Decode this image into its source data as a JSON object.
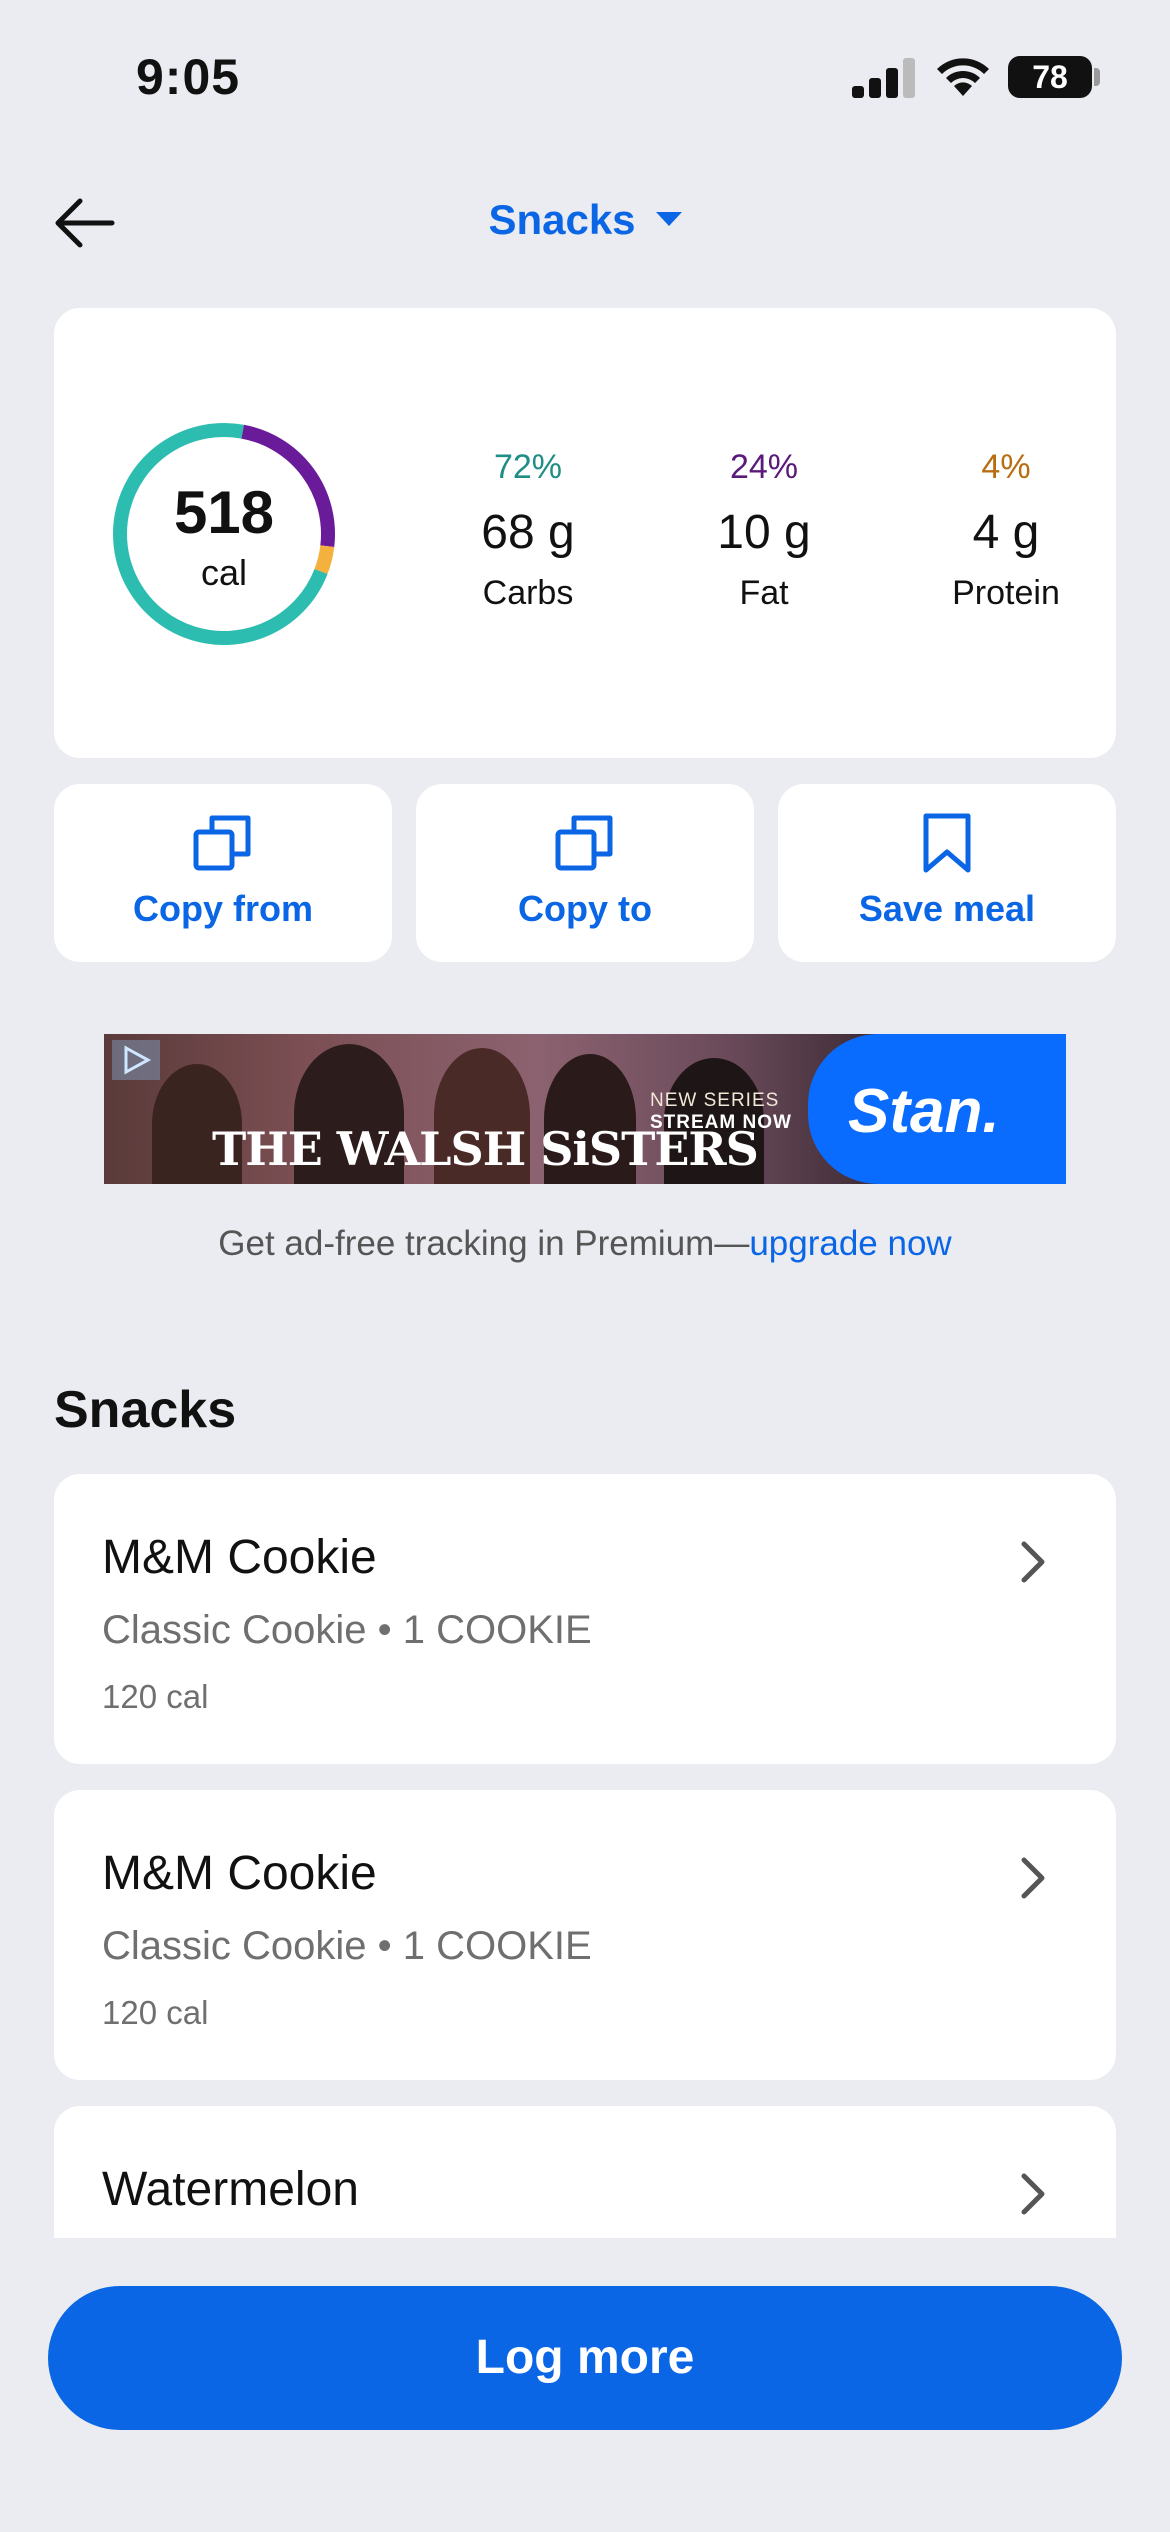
{
  "status_bar": {
    "time": "9:05",
    "battery": "78"
  },
  "header": {
    "title": "Snacks"
  },
  "summary": {
    "calories": "518",
    "calories_unit": "cal",
    "ring_fractions": {
      "carbs": 0.72,
      "fat": 0.24,
      "protein": 0.04
    },
    "macros": [
      {
        "pct": "72%",
        "grams": "68 g",
        "name": "Carbs",
        "color": "#1f8f86"
      },
      {
        "pct": "24%",
        "grams": "10 g",
        "name": "Fat",
        "color": "#5b1a7a"
      },
      {
        "pct": "4%",
        "grams": "4 g",
        "name": "Protein",
        "color": "#b86e10"
      }
    ],
    "ring_colors": {
      "carbs": "#2dbdb0",
      "fat": "#6a1b9a",
      "protein": "#f5b13d"
    }
  },
  "actions": [
    {
      "label": "Copy from",
      "icon": "copy-icon"
    },
    {
      "label": "Copy to",
      "icon": "copy-icon"
    },
    {
      "label": "Save meal",
      "icon": "bookmark-icon"
    }
  ],
  "ad": {
    "show_title": "THE WALSH SiSTERS",
    "new_series": "NEW SERIES",
    "stream_now": "STREAM NOW",
    "brand": "Stan.",
    "note_text": "Get ad-free tracking in Premium—",
    "note_link": "upgrade now"
  },
  "section": {
    "title": "Snacks"
  },
  "foods": [
    {
      "name": "M&M Cookie",
      "desc": "Classic Cookie • 1 COOKIE",
      "cal": "120 cal"
    },
    {
      "name": "M&M Cookie",
      "desc": "Classic Cookie • 1 COOKIE",
      "cal": "120 cal"
    },
    {
      "name": "Watermelon",
      "desc": "",
      "cal": ""
    }
  ],
  "log_more": {
    "label": "Log more"
  },
  "colors": {
    "accent": "#0a66e4",
    "background": "#ebecf1"
  }
}
